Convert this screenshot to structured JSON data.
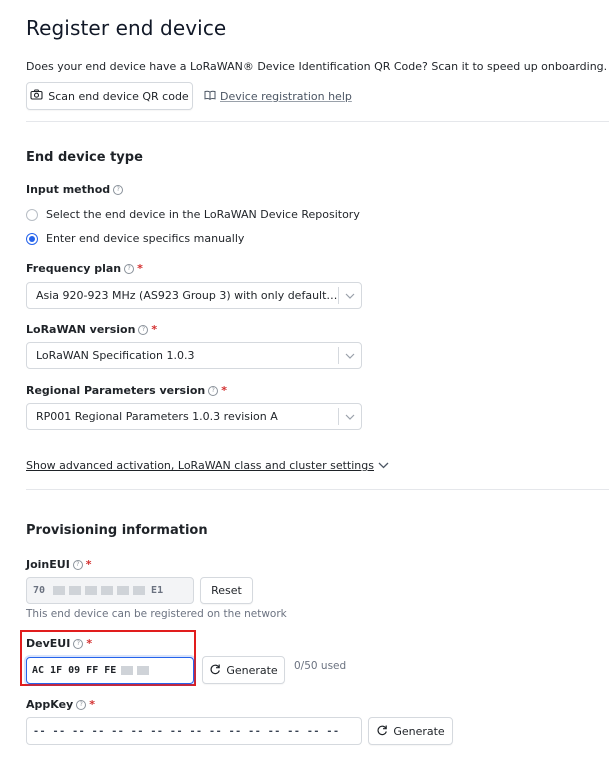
{
  "header": {
    "title": "Register end device",
    "intro": "Does your end device have a LoRaWAN® Device Identification QR Code? Scan it to speed up onboarding.",
    "scan_button": "Scan end device QR code",
    "help_link": "Device registration help"
  },
  "end_device_type": {
    "section_title": "End device type",
    "input_method": {
      "label": "Input method",
      "options": [
        {
          "label": "Select the end device in the LoRaWAN Device Repository",
          "selected": false
        },
        {
          "label": "Enter end device specifics manually",
          "selected": true
        }
      ]
    },
    "frequency_plan": {
      "label": "Frequency plan",
      "value": "Asia 920-923 MHz (AS923 Group 3) with only default channels"
    },
    "lorawan_version": {
      "label": "LoRaWAN version",
      "value": "LoRaWAN Specification 1.0.3"
    },
    "regional_params": {
      "label": "Regional Parameters version",
      "value": "RP001 Regional Parameters 1.0.3 revision A"
    },
    "advanced_link": "Show advanced activation, LoRaWAN class and cluster settings"
  },
  "provisioning": {
    "section_title": "Provisioning information",
    "join_eui": {
      "label": "JoinEUI",
      "prefix": "70",
      "suffix": "E1",
      "reset_button": "Reset",
      "hint": "This end device can be registered on the network"
    },
    "dev_eui": {
      "label": "DevEUI",
      "value": "AC 1F 09 FF FE",
      "generate_button": "Generate",
      "usage": "0/50 used"
    },
    "app_key": {
      "label": "AppKey",
      "value": "-- -- -- -- -- -- -- -- -- -- -- -- -- -- -- --",
      "generate_button": "Generate"
    }
  },
  "colors": {
    "accent": "#2563eb",
    "required": "#d32f2f",
    "highlight": "#e11d1d"
  }
}
